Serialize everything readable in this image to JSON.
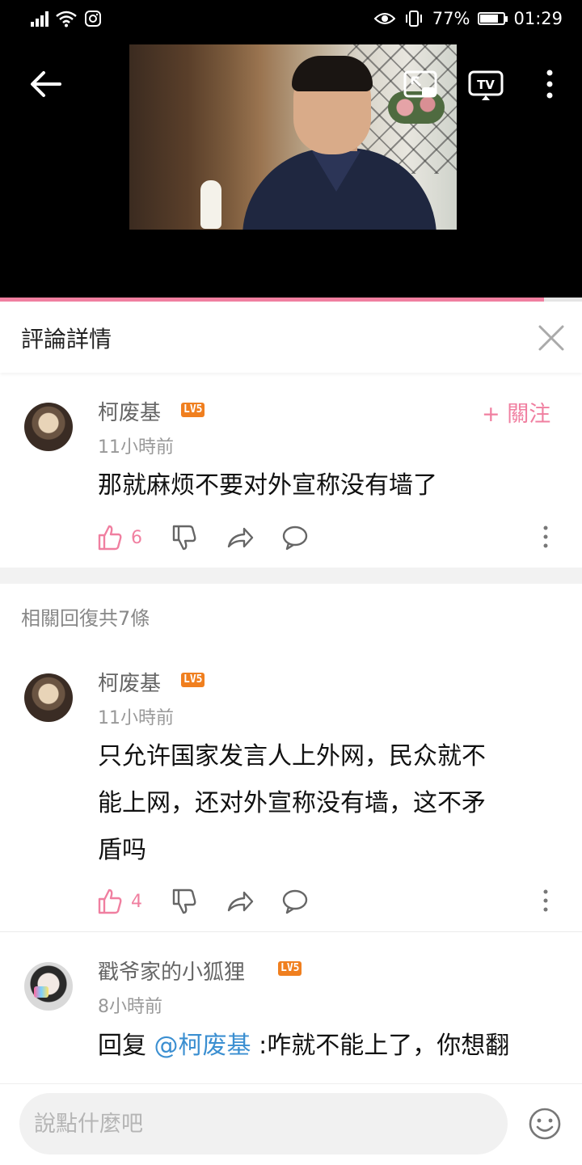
{
  "status_bar": {
    "battery": "77%",
    "battery_level": 0.77,
    "time": "01:29"
  },
  "video": {
    "progress": 0.935
  },
  "panel": {
    "title": "評論詳情"
  },
  "main_comment": {
    "username": "柯废基",
    "level": "LV5",
    "time": "11小時前",
    "text": "那就麻烦不要对外宣称没有墙了",
    "likes": "6",
    "follow_label": "+ 關注"
  },
  "replies_header": "相關回復共7條",
  "replies": [
    {
      "username": "柯废基",
      "level": "LV5",
      "time": "11小時前",
      "text_line1": "只允许国家发言人上外网，民众就不",
      "text_line2": "能上网，还对外宣称没有墙，这不矛",
      "text_line3": "盾吗",
      "likes": "4"
    },
    {
      "username": "戳爷家的小狐狸",
      "level": "LV5",
      "time": "8小時前",
      "reply_prefix": "回复 ",
      "mention": "@柯废基",
      "text_line1": " :咋就不能上了，你想翻"
    }
  ],
  "input": {
    "placeholder": "說點什麼吧"
  },
  "colors": {
    "accent": "#f07fa0",
    "level_badge": "#f07f1f",
    "mention": "#3b8fd1"
  },
  "icons": [
    "wifi-icon",
    "signal-icon",
    "instagram-icon",
    "eye-icon",
    "vibrate-icon",
    "battery-icon",
    "back-arrow-icon",
    "cast-icon",
    "tv-icon",
    "more-vertical-icon",
    "close-icon",
    "thumbs-up-icon",
    "thumbs-down-icon",
    "share-icon",
    "comment-icon",
    "emoji-icon"
  ]
}
